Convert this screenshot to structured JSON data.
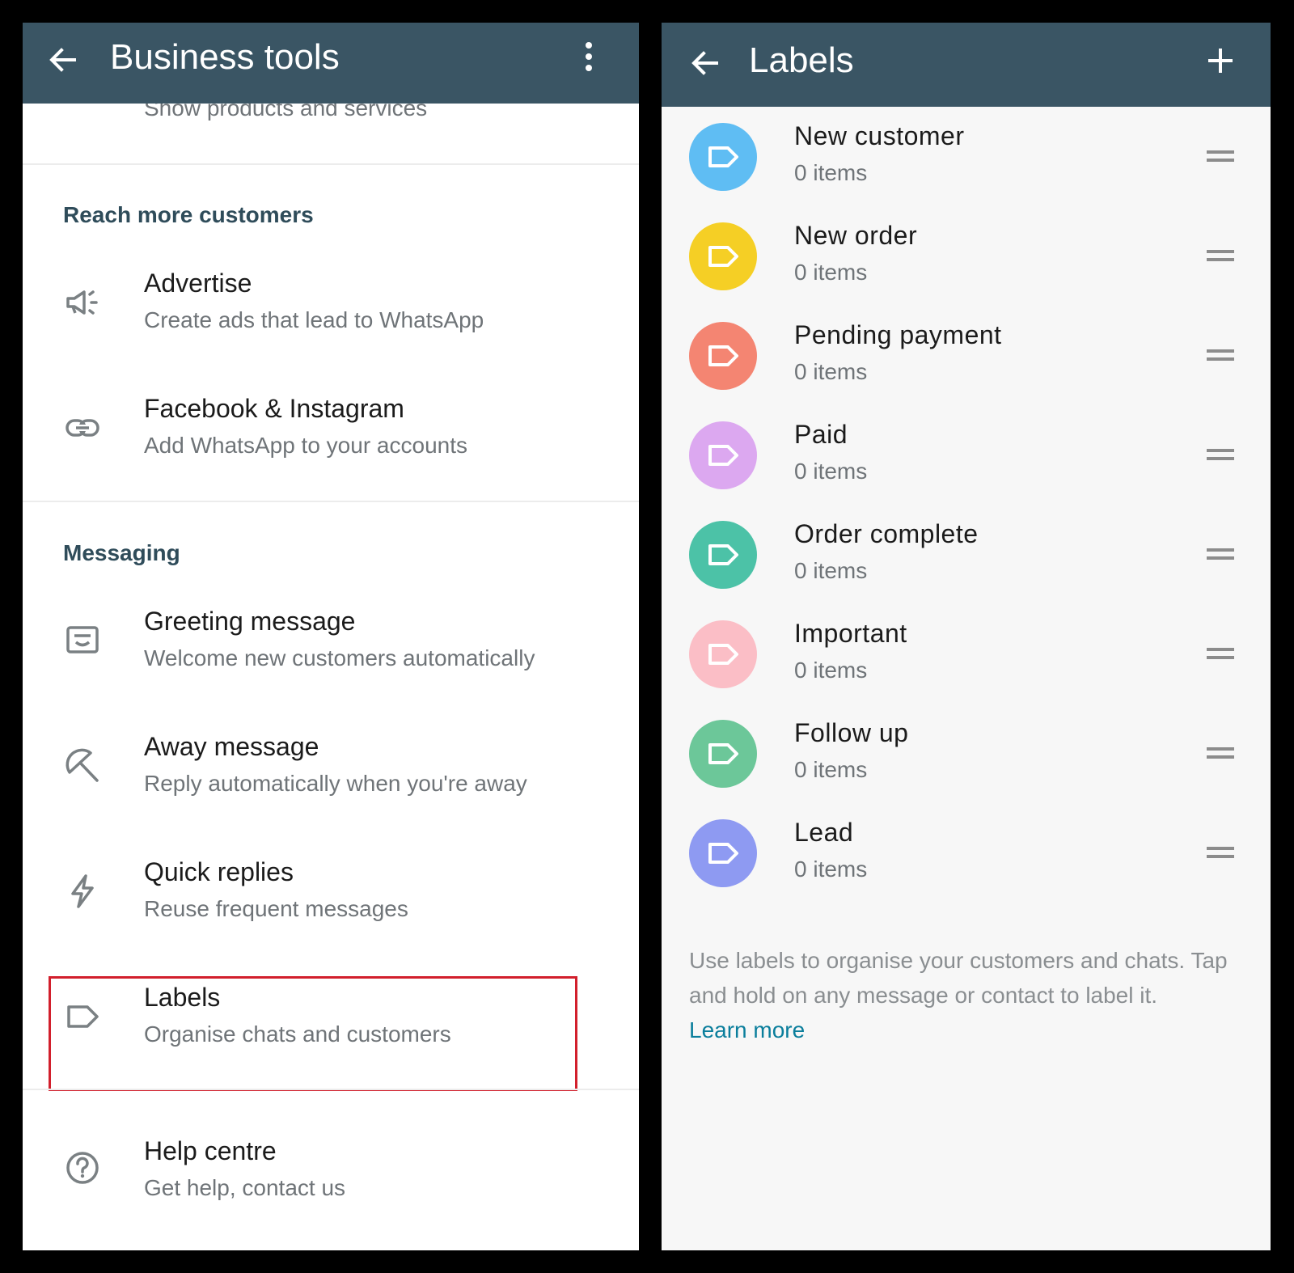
{
  "left_panel": {
    "appbar": {
      "title": "Business tools",
      "back_icon": "arrow-left-icon",
      "menu_icon": "more-vertical-icon"
    },
    "partial_item_subtitle": "Show products and services",
    "sections": {
      "reach": {
        "header": "Reach more customers",
        "items": [
          {
            "title": "Advertise",
            "subtitle": "Create ads that lead to WhatsApp",
            "icon": "megaphone-icon"
          },
          {
            "title": "Facebook & Instagram",
            "subtitle": "Add WhatsApp to your accounts",
            "icon": "link-icon"
          }
        ]
      },
      "messaging": {
        "header": "Messaging",
        "items": [
          {
            "title": "Greeting message",
            "subtitle": "Welcome new customers automatically",
            "icon": "greeting-message-icon"
          },
          {
            "title": "Away message",
            "subtitle": "Reply automatically when you're away",
            "icon": "away-umbrella-icon"
          },
          {
            "title": "Quick replies",
            "subtitle": "Reuse frequent messages",
            "icon": "lightning-icon"
          },
          {
            "title": "Labels",
            "subtitle": "Organise chats and customers",
            "icon": "label-tag-icon"
          }
        ]
      }
    },
    "help": {
      "title": "Help centre",
      "subtitle": "Get help, contact us",
      "icon": "help-circle-icon"
    },
    "highlight_color": "#d21f2c"
  },
  "right_panel": {
    "appbar": {
      "title": "Labels",
      "back_icon": "arrow-left-icon",
      "add_icon": "plus-icon"
    },
    "labels": [
      {
        "name": "New customer",
        "count": "0 items",
        "color": "#5fbdf3"
      },
      {
        "name": "New order",
        "count": "0 items",
        "color": "#f5cf25"
      },
      {
        "name": "Pending payment",
        "count": "0 items",
        "color": "#f48572"
      },
      {
        "name": "Paid",
        "count": "0 items",
        "color": "#dca8f0"
      },
      {
        "name": "Order complete",
        "count": "0 items",
        "color": "#4cc2a7"
      },
      {
        "name": "Important",
        "count": "0 items",
        "color": "#fbbec6"
      },
      {
        "name": "Follow up",
        "count": "0 items",
        "color": "#6cc799"
      },
      {
        "name": "Lead",
        "count": "0 items",
        "color": "#8e9af2"
      }
    ],
    "footer": {
      "text": "Use labels to organise your customers and chats. Tap and hold on any message or contact to label it.",
      "link": "Learn more"
    }
  },
  "colors": {
    "appbar": "#3a5564",
    "section_header": "#2f4c5a",
    "link": "#0a7e9c"
  }
}
